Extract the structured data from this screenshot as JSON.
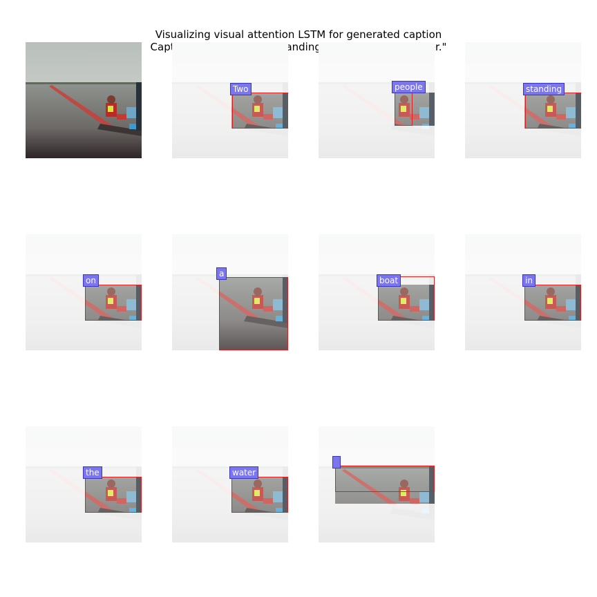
{
  "figure": {
    "title_line1": "Visualizing visual attention LSTM for generated caption",
    "title_line2": "Caption: 0, \"Two people standing on a boat in the water.\""
  },
  "panels": [
    {
      "word": null
    },
    {
      "word": "Two"
    },
    {
      "word": "people"
    },
    {
      "word": "standing"
    },
    {
      "word": "on"
    },
    {
      "word": "a"
    },
    {
      "word": "boat"
    },
    {
      "word": "in"
    },
    {
      "word": "the"
    },
    {
      "word": "water"
    },
    {
      "word": ""
    }
  ],
  "colors": {
    "word_label_bg": "#7b76ee",
    "attention_box": "#e02020"
  }
}
